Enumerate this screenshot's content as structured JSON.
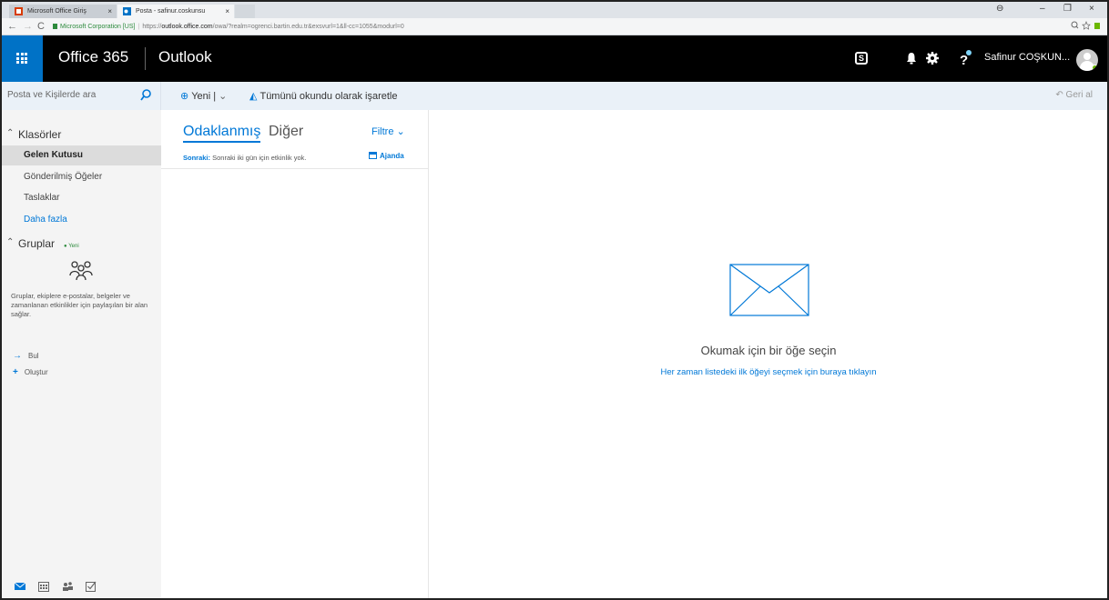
{
  "browser": {
    "tabs": [
      {
        "title": "Microsoft Office Giriş",
        "close": "×"
      },
      {
        "title": "Posta - safinur.coskunsu",
        "close": "×"
      }
    ],
    "window_controls": [
      "⊖",
      "–",
      "❐",
      "×"
    ],
    "address": {
      "org": "Microsoft Corporation [US]",
      "scheme": "https://",
      "host": "outlook.office.com",
      "path": "/owa/?realm=ogrenci.bartin.edu.tr&exsvurl=1&ll-cc=1055&modurl=0"
    }
  },
  "header": {
    "brand": "Office 365",
    "app": "Outlook",
    "user": "Safinur COŞKUN..."
  },
  "commands": {
    "search_placeholder": "Posta ve Kişilerde ara",
    "new_label": "Yeni |",
    "mark_all_read": "Tümünü okundu olarak işaretle",
    "undo": "Geri al"
  },
  "nav": {
    "folders_header": "Klasörler",
    "folders": [
      "Gelen Kutusu",
      "Gönderilmiş Öğeler",
      "Taslaklar"
    ],
    "more": "Daha fazla",
    "groups_header": "Gruplar",
    "groups_new_badge": "Yeni",
    "groups_description": "Gruplar, ekiplere e-postalar, belgeler ve zamanlanan etkinlikler için paylaşılan bir alan sağlar.",
    "find": "Bul",
    "create": "Oluştur"
  },
  "list": {
    "focused_tab": "Odaklanmış",
    "other_tab": "Diğer",
    "filter": "Filtre",
    "next_label": "Sonraki:",
    "next_text": "Sonraki iki gün için etkinlik yok.",
    "agenda": "Ajanda"
  },
  "reading": {
    "empty_title": "Okumak için bir öğe seçin",
    "empty_link": "Her zaman listedeki ilk öğeyi seçmek için buraya tıklayın"
  },
  "colors": {
    "accent": "#0078d7",
    "waffle": "#0072c6",
    "header_bg": "#000000",
    "command_bg": "#eaf1f8",
    "nav_bg": "#f4f4f4"
  }
}
